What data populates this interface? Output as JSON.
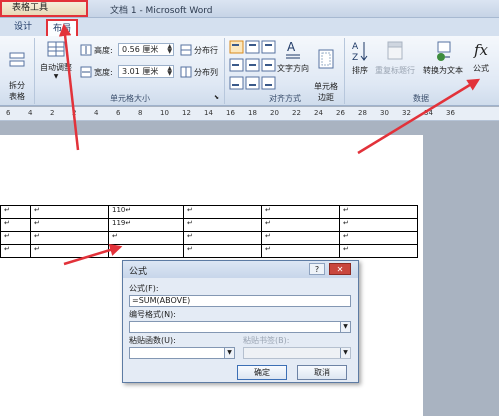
{
  "titlebar": {
    "tool_context": "表格工具",
    "window_title": "文档 1 - Microsoft Word"
  },
  "tabs": [
    {
      "label": "设计"
    },
    {
      "label": "布局"
    }
  ],
  "ribbon": {
    "split_table": "拆分\n表格",
    "autofit": "自动调整",
    "height_label": "高度:",
    "height_value": "0.56 厘米",
    "width_label": "宽度:",
    "width_value": "3.01 厘米",
    "distribute_rows": "分布行",
    "distribute_cols": "分布列",
    "cell_size_group": "单元格大小",
    "text_direction": "文字方向",
    "cell_margins": "单元格\n边距",
    "alignment_group": "对齐方式",
    "sort": "排序",
    "repeat_header": "重复标题行",
    "convert_to_text": "转换为文本",
    "formula": "公式",
    "formula_icon": "fx",
    "data_group": "数据"
  },
  "ruler": [
    "6",
    "4",
    "2",
    "2",
    "4",
    "6",
    "8",
    "10",
    "12",
    "14",
    "16",
    "18",
    "20",
    "22",
    "24",
    "26",
    "28",
    "30",
    "32",
    "34",
    "36"
  ],
  "table": {
    "rows": [
      [
        "↵",
        "↵",
        "110↵",
        "↵",
        "↵",
        "↵"
      ],
      [
        "↵",
        "↵",
        "119↵",
        "↵",
        "↵",
        "↵"
      ],
      [
        "↵",
        "↵",
        "↵",
        "↵",
        "↵",
        "↵"
      ],
      [
        "↵",
        "↵",
        "↵",
        "↵",
        "↵",
        "↵"
      ]
    ]
  },
  "dialog": {
    "title": "公式",
    "help": "?",
    "close": "✕",
    "formula_label": "公式(F):",
    "formula_value": "=SUM(ABOVE)",
    "number_format_label": "编号格式(N):",
    "number_format_value": "",
    "paste_function_label": "粘贴函数(U):",
    "paste_bookmark_label": "粘贴书签(B):",
    "ok": "确定",
    "cancel": "取消"
  },
  "colors": {
    "annotation": "#e2323a",
    "ribbon": "#dfe8f4"
  }
}
